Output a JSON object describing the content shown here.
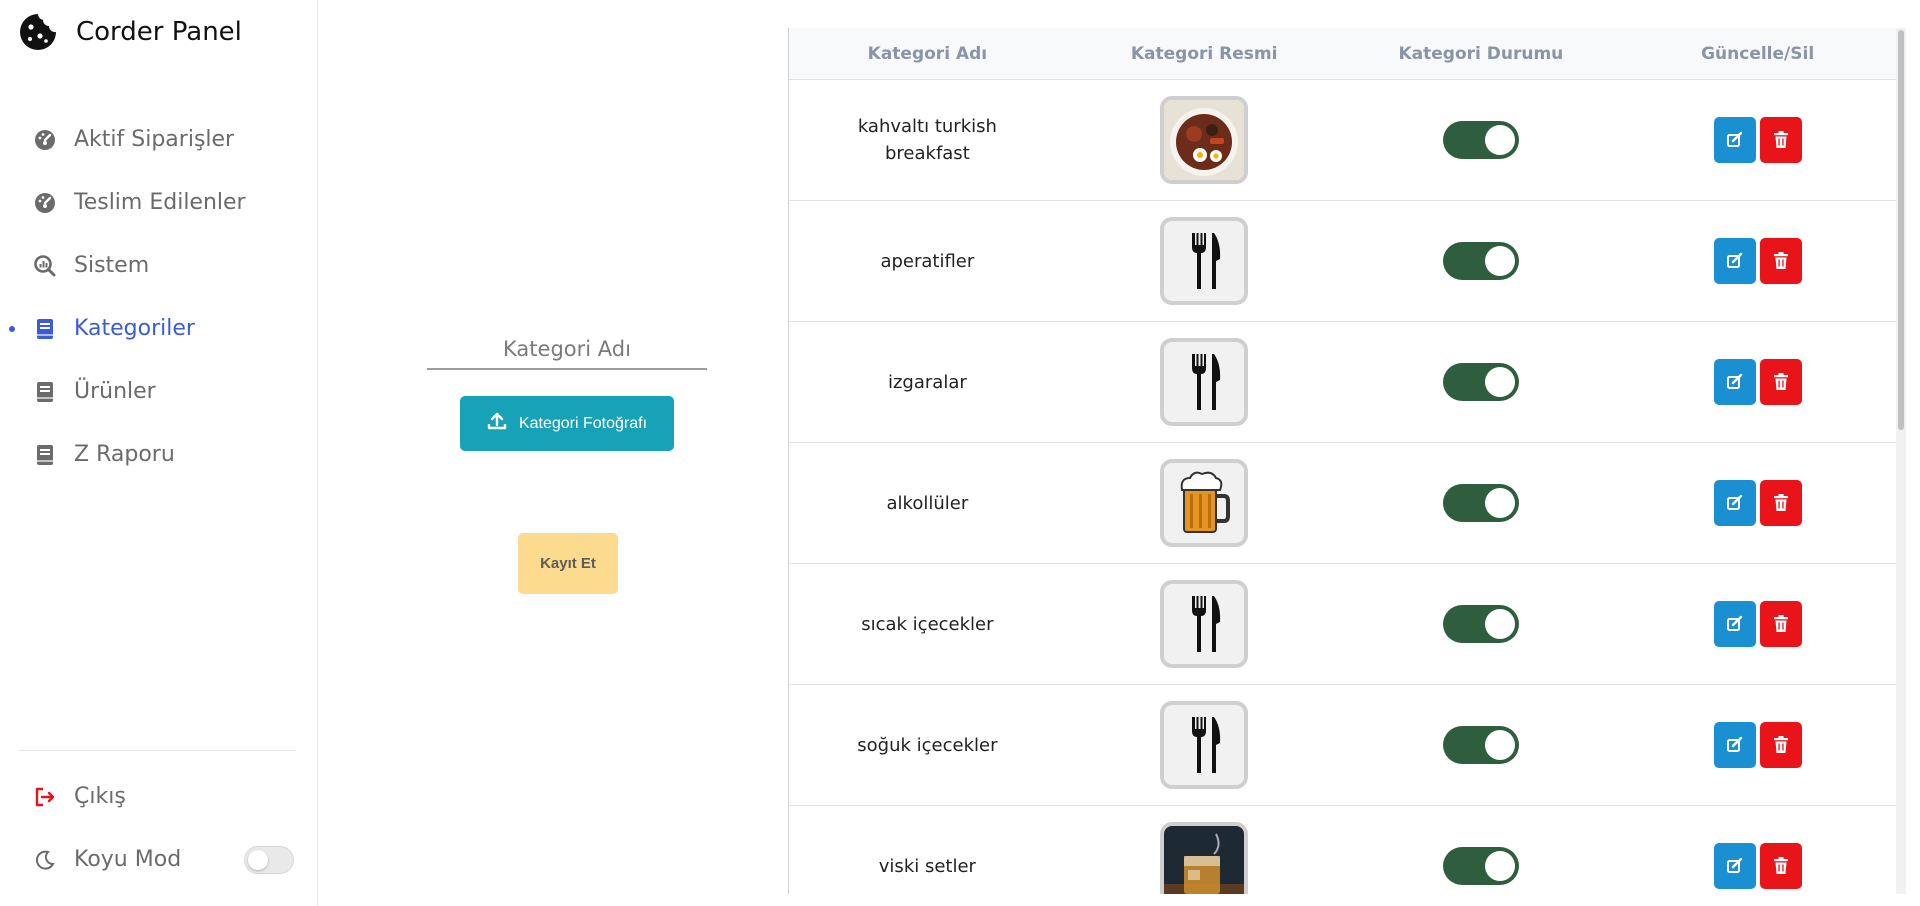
{
  "app": {
    "title": "Corder Panel"
  },
  "sidebar": {
    "items": [
      {
        "label": "Aktif Siparişler",
        "icon": "dashboard-icon",
        "active": false
      },
      {
        "label": "Teslim Edilenler",
        "icon": "dashboard-icon",
        "active": false
      },
      {
        "label": "Sistem",
        "icon": "search-chart-icon",
        "active": false
      },
      {
        "label": "Kategoriler",
        "icon": "book-icon",
        "active": true
      },
      {
        "label": "Ürünler",
        "icon": "book-icon",
        "active": false
      },
      {
        "label": "Z Raporu",
        "icon": "book-icon",
        "active": false
      }
    ],
    "logout": {
      "label": "Çıkış",
      "icon": "logout-icon",
      "color": "#e8141a"
    },
    "dark_mode": {
      "label": "Koyu Mod",
      "icon": "moon-icon",
      "enabled": false
    }
  },
  "form": {
    "name_placeholder": "Kategori Adı",
    "upload_label": "Kategori Fotoğrafı",
    "save_label": "Kayıt Et"
  },
  "table": {
    "headers": [
      "Kategori Adı",
      "Kategori Resmi",
      "Kategori Durumu",
      "Güncelle/Sil"
    ],
    "rows": [
      {
        "name": "kahvaltı turkish breakfast",
        "image": "breakfast-photo",
        "active": true
      },
      {
        "name": "aperatifler",
        "image": "cutlery-icon",
        "active": true
      },
      {
        "name": "izgaralar",
        "image": "cutlery-icon",
        "active": true
      },
      {
        "name": "alkollüler",
        "image": "beer-mug-icon",
        "active": true
      },
      {
        "name": "sıcak içecekler",
        "image": "cutlery-icon",
        "active": true
      },
      {
        "name": "soğuk içecekler",
        "image": "cutlery-icon",
        "active": true
      },
      {
        "name": "viski setler",
        "image": "whiskey-photo",
        "active": true
      }
    ]
  },
  "colors": {
    "accent": "#3b5bdb",
    "upload": "#17a2b8",
    "save": "#fddb8e",
    "toggle_on": "#2f5e3f",
    "edit": "#1a8fd1",
    "delete": "#e8141a"
  }
}
